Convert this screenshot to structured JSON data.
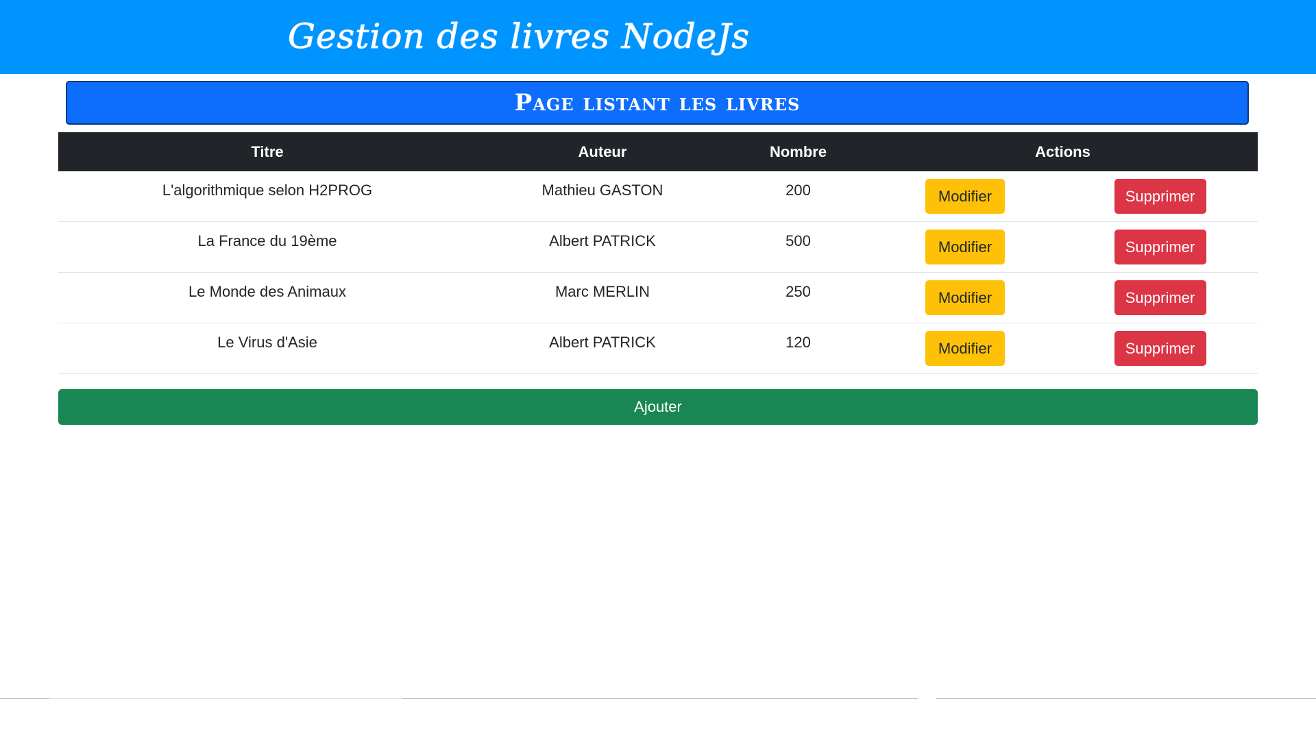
{
  "header": {
    "app_title": "Gestion des livres NodeJs",
    "background": "#0094ff"
  },
  "page_heading": "Page listant les livres",
  "table": {
    "columns": [
      "Titre",
      "Auteur",
      "Nombre",
      "Actions"
    ],
    "rows": [
      {
        "titre": "L'algorithmique selon H2PROG",
        "auteur": "Mathieu GASTON",
        "nombre": "200"
      },
      {
        "titre": "La France du 19ème",
        "auteur": "Albert PATRICK",
        "nombre": "500"
      },
      {
        "titre": "Le Monde des Animaux",
        "auteur": "Marc MERLIN",
        "nombre": "250"
      },
      {
        "titre": "Le Virus d'Asie",
        "auteur": "Albert PATRICK",
        "nombre": "120"
      }
    ],
    "modify_label": "Modifier",
    "delete_label": "Supprimer"
  },
  "add_button_label": "Ajouter",
  "colors": {
    "heading": "#0d6efd",
    "table_header": "#212529",
    "modify": "#ffc107",
    "delete": "#dc3545",
    "add": "#198754"
  }
}
